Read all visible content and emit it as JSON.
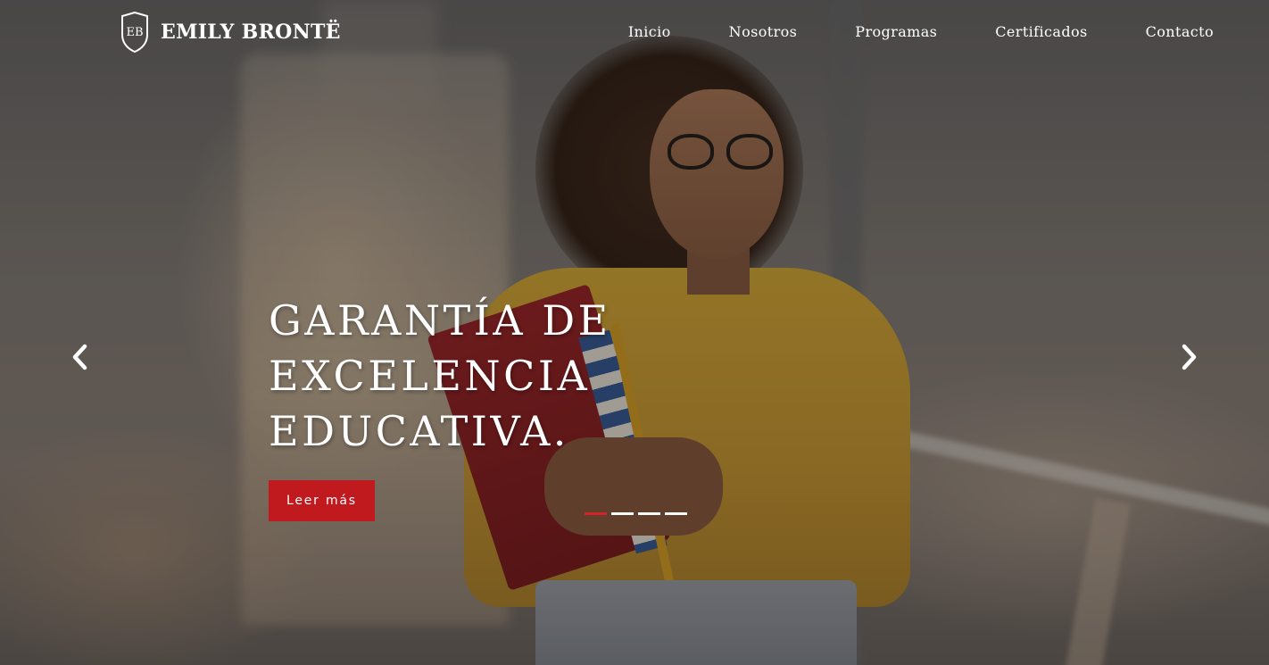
{
  "brand": {
    "name": "EMILY BRONTË",
    "logo_icon": "shield-crest-icon",
    "logo_lettering": "EB"
  },
  "nav": {
    "items": [
      {
        "label": "Inicio"
      },
      {
        "label": "Nosotros"
      },
      {
        "label": "Programas"
      },
      {
        "label": "Certificados"
      },
      {
        "label": "Contacto"
      }
    ]
  },
  "hero": {
    "headline_line1": "GARANTÍA DE EXCELENCIA",
    "headline_line2": "EDUCATIVA.",
    "cta_label": "Leer más"
  },
  "carousel": {
    "prev_icon": "chevron-left-icon",
    "next_icon": "chevron-right-icon",
    "slide_count": 4,
    "active_slide": 1
  },
  "colors": {
    "accent": "#c0191e",
    "indicator_active": "#d1242a",
    "text": "#ffffff"
  }
}
